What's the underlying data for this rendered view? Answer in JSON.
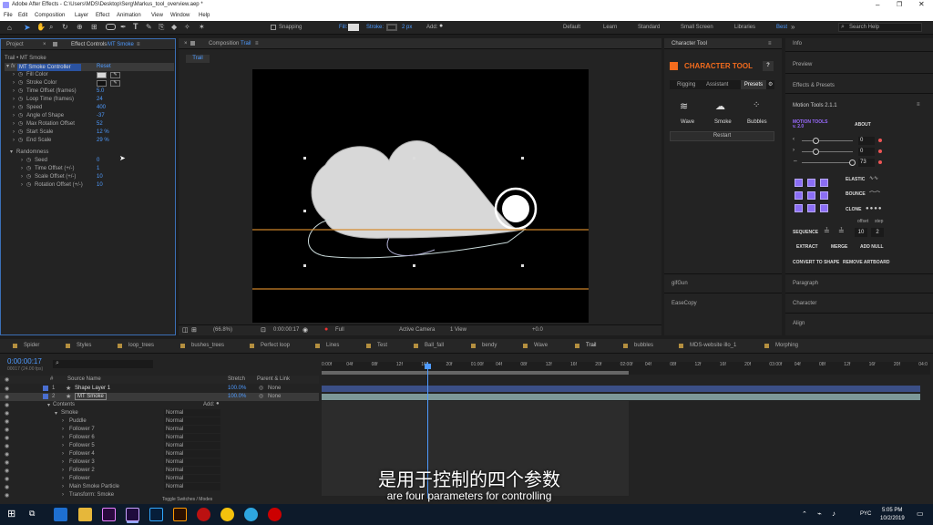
{
  "window_title": "Adobe After Effects - C:\\Users\\MDS\\Desktop\\Serg\\Markus_tool_overview.aep *",
  "menu": [
    "File",
    "Edit",
    "Composition",
    "Layer",
    "Effect",
    "Animation",
    "View",
    "Window",
    "Help"
  ],
  "toolbar": {
    "snapping": "Snapping",
    "fill": "Fill:",
    "stroke": "Stroke:",
    "stroke_px": "2 px",
    "add": "Add:"
  },
  "workspaces": [
    "Default",
    "Learn",
    "Standard",
    "Small Screen",
    "Libraries",
    "Best"
  ],
  "search_placeholder": "Search Help",
  "left_panel": {
    "tab_project": "Project",
    "tab_effects": "Effect Controls",
    "tab_effects_layer": "MT Smoke",
    "breadcrumb": "Trail • MT Smoke",
    "fx_name": "MT Smoke Controller",
    "reset": "Reset",
    "props": [
      {
        "label": "Fill Color",
        "value": ""
      },
      {
        "label": "Stroke Color",
        "value": ""
      },
      {
        "label": "Time Offset (frames)",
        "value": "5.0"
      },
      {
        "label": "Loop Time (frames)",
        "value": "24"
      },
      {
        "label": "Speed",
        "value": "400"
      },
      {
        "label": "Angle of Shape",
        "value": "-37"
      },
      {
        "label": "Max Rotation Offset",
        "value": "52"
      },
      {
        "label": "Start Scale",
        "value": "12 %"
      },
      {
        "label": "End Scale",
        "value": "29 %"
      }
    ],
    "randomness": "Randomness",
    "rand_props": [
      {
        "label": "Seed",
        "value": "0"
      },
      {
        "label": "Time Offset (+/-)",
        "value": "1"
      },
      {
        "label": "Scale Offset (+/-)",
        "value": "10"
      },
      {
        "label": "Rotation Offset (+/-)",
        "value": "10"
      }
    ]
  },
  "comp_panel": {
    "tab_label": "Composition",
    "tab_name": "Trail",
    "subtab": "Trail",
    "zoom": "(66.8%)",
    "time": "0:00:00:17",
    "quality": "Full",
    "camera": "Active Camera",
    "views": "1 View",
    "exposure": "+0.0"
  },
  "character_tool": {
    "panel_title": "Character Tool",
    "brand": "CHARACTER TOOL",
    "help": "?",
    "tabs": [
      "Rigging",
      "Assistant",
      "Presets"
    ],
    "presets": [
      "Wave",
      "Smoke",
      "Bubbles"
    ],
    "restart": "Restart",
    "sections": [
      "gifGun",
      "EaseCopy"
    ]
  },
  "right_panel": {
    "items": [
      "Info",
      "Preview",
      "Effects & Presets"
    ],
    "motion_tools": "Motion Tools 2.1.1",
    "mt_logo": "MOTION TOOLS v. 2.0",
    "about": "ABOUT",
    "sliders": [
      {
        "value": "0"
      },
      {
        "value": "0"
      },
      {
        "value": "73"
      }
    ],
    "elastic": "ELASTIC",
    "bounce": "BOUNCE",
    "clone": "CLONE",
    "offset": "offset",
    "step": "step",
    "sequence": "SEQUENCE",
    "seq_offset": "10",
    "seq_step": "2",
    "extract": "EXTRACT",
    "merge": "MERGE",
    "add_null": "ADD NULL",
    "convert": "CONVERT TO SHAPE",
    "remove": "REMOVE ARTBOARD",
    "bottom": [
      "Paragraph",
      "Character",
      "Align"
    ]
  },
  "timeline_tabs": [
    "Spider",
    "Styles",
    "loop_trees",
    "bushes_trees",
    "Perfect loop",
    "Lines",
    "Test",
    "Ball_fall",
    "bendy",
    "Wave",
    "Trail",
    "bubbles",
    "MDS-website illo_1",
    "Morphing"
  ],
  "timeline": {
    "timecode": "0:00:00:17",
    "fps": "00017 (24.00 fps)",
    "col_source": "Source Name",
    "col_stretch": "Stretch",
    "col_parent": "Parent & Link",
    "layers": [
      {
        "num": "1",
        "name": "Shape Layer 1",
        "stretch": "100.0%",
        "parent": "None"
      },
      {
        "num": "2",
        "name": "MT Smoke",
        "stretch": "100.0%",
        "parent": "None"
      }
    ],
    "contents": "Contents",
    "add": "Add:",
    "smoke": "Smoke",
    "sublayers": [
      "Puddle",
      "Follower 7",
      "Follower 6",
      "Follower 5",
      "Follower 4",
      "Follower 3",
      "Follower 2",
      "Follower",
      "Main Smoke Particle",
      "Transform: Smoke"
    ],
    "mode": "Normal",
    "ruler": [
      "0:00f",
      "04f",
      "08f",
      "12f",
      "16f",
      "20f",
      "01:00f",
      "04f",
      "08f",
      "12f",
      "16f",
      "20f",
      "02:00f",
      "04f",
      "08f",
      "12f",
      "16f",
      "20f",
      "03:00f",
      "04f",
      "08f",
      "12f",
      "16f",
      "20f",
      "04:0"
    ],
    "toggle": "Toggle Switches / Modes"
  },
  "subtitle": {
    "zh": "是用于控制的四个参数",
    "en": "are four parameters for controlling"
  },
  "taskbar": {
    "time": "5:05 PM",
    "date": "10/2/2019",
    "lang": "PYC"
  }
}
